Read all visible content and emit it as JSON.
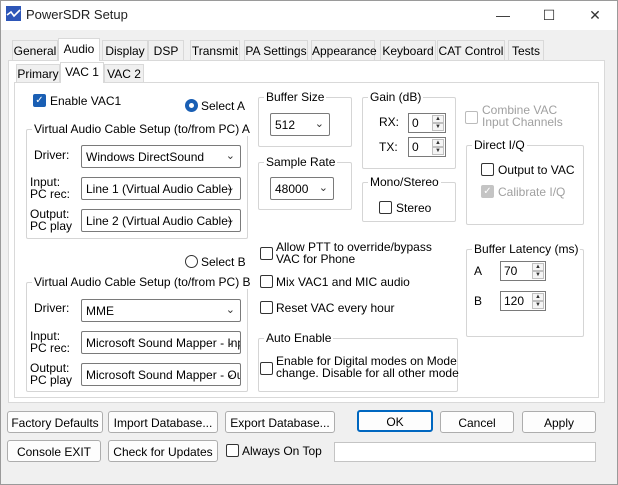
{
  "window": {
    "title": "PowerSDR Setup",
    "minimize": "—",
    "maximize": "☐",
    "close": "✕"
  },
  "tabs": [
    "General",
    "Audio",
    "Display",
    "DSP",
    "Transmit",
    "PA Settings",
    "Appearance",
    "Keyboard",
    "CAT Control",
    "Tests"
  ],
  "active_tab": "Audio",
  "subtabs": [
    "Primary",
    "VAC 1",
    "VAC 2"
  ],
  "active_subtab": "VAC 1",
  "vac": {
    "enable_label": "Enable VAC1",
    "enable_checked": true,
    "select_a_label": "Select A",
    "select_b_label": "Select B",
    "setup_a": {
      "title": "Virtual Audio Cable Setup (to/from PC)  A",
      "driver_label": "Driver:",
      "driver_value": "Windows DirectSound",
      "input_label_1": "Input:",
      "input_label_2": "PC rec:",
      "input_value": "Line 1 (Virtual Audio Cable)",
      "output_label_1": "Output:",
      "output_label_2": "PC play",
      "output_value": "Line 2 (Virtual Audio Cable)"
    },
    "setup_b": {
      "title": "Virtual Audio Cable Setup (to/from PC)  B",
      "driver_label": "Driver:",
      "driver_value": "MME",
      "input_label_1": "Input:",
      "input_label_2": "PC rec:",
      "input_value": "Microsoft Sound Mapper - Inp",
      "output_label_1": "Output:",
      "output_label_2": "PC play",
      "output_value": "Microsoft Sound Mapper - Ou"
    },
    "buffer_size": {
      "title": "Buffer Size",
      "value": "512"
    },
    "sample_rate": {
      "title": "Sample Rate",
      "value": "48000"
    },
    "gain": {
      "title": "Gain (dB)",
      "rx_label": "RX:",
      "rx_value": "0",
      "tx_label": "TX:",
      "tx_value": "0"
    },
    "mono_stereo": {
      "title": "Mono/Stereo",
      "stereo_label": "Stereo"
    },
    "combine_label_1": "Combine VAC",
    "combine_label_2": "Input Channels",
    "direct_iq": {
      "title": "Direct I/Q",
      "output_label": "Output to VAC",
      "calibrate_label": "Calibrate I/Q"
    },
    "allow_ptt_1": "Allow PTT to override/bypass",
    "allow_ptt_2": "VAC for Phone",
    "mix_label": "Mix VAC1 and MIC audio",
    "reset_label": "Reset VAC every hour",
    "auto_enable": {
      "title": "Auto Enable",
      "label_1": "Enable for Digital modes on Mode",
      "label_2": "change.  Disable for all other mode"
    },
    "buffer_latency": {
      "title": "Buffer Latency (ms)",
      "a_label": "A",
      "a_value": "70",
      "b_label": "B",
      "b_value": "120"
    }
  },
  "footer": {
    "factory_defaults": "Factory Defaults",
    "import_db": "Import Database...",
    "export_db": "Export Database...",
    "ok": "OK",
    "cancel": "Cancel",
    "apply": "Apply",
    "console_exit": "Console EXIT",
    "check_updates": "Check for Updates",
    "always_on_top": "Always On Top"
  }
}
